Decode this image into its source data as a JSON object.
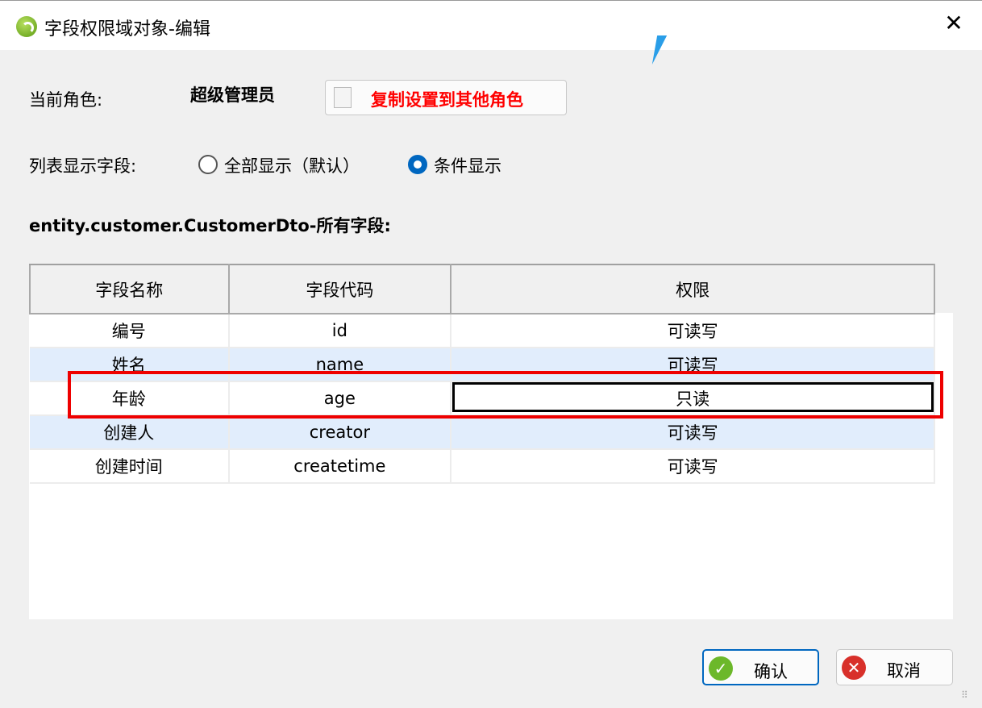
{
  "window": {
    "title": "字段权限域对象-编辑",
    "close_icon": "close-icon"
  },
  "role": {
    "label": "当前角色:",
    "value": "超级管理员",
    "copy_button": "复制设置到其他角色"
  },
  "display": {
    "label": "列表显示字段:",
    "options": [
      {
        "label": "全部显示（默认）",
        "selected": false
      },
      {
        "label": "条件显示",
        "selected": true
      }
    ]
  },
  "section_title": "entity.customer.CustomerDto-所有字段:",
  "table": {
    "headers": [
      "字段名称",
      "字段代码",
      "权限"
    ],
    "rows": [
      [
        "编号",
        "id",
        "可读写"
      ],
      [
        "姓名",
        "name",
        "可读写"
      ],
      [
        "年龄",
        "age",
        "只读"
      ],
      [
        "创建人",
        "creator",
        "可读写"
      ],
      [
        "创建时间",
        "createtime",
        "可读写"
      ]
    ]
  },
  "buttons": {
    "ok": "确认",
    "cancel": "取消"
  },
  "colors": {
    "highlight": "#e00000",
    "accent": "#0067c0",
    "alt_row": "#e1edfc"
  }
}
